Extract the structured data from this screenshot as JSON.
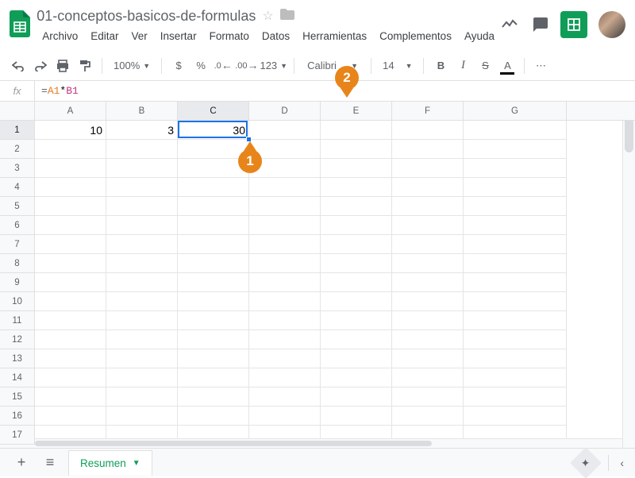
{
  "document": {
    "title": "01-conceptos-basicos-de-formulas"
  },
  "menu": {
    "archivo": "Archivo",
    "editar": "Editar",
    "ver": "Ver",
    "insertar": "Insertar",
    "formato": "Formato",
    "datos": "Datos",
    "herramientas": "Herramientas",
    "complementos": "Complementos",
    "ayuda": "Ayuda"
  },
  "toolbar": {
    "zoom": "100%",
    "currency": "$",
    "percent": "%",
    "dec_less": ".0",
    "dec_more": ".00",
    "num_format": "123",
    "font": "Calibri",
    "size": "14",
    "bold": "B",
    "italic": "I",
    "strike": "S",
    "textcolor": "A",
    "more": "⋯"
  },
  "formula": {
    "fx": "fx",
    "eq": "=",
    "ref1": "A1",
    "op": "*",
    "ref2": "B1"
  },
  "columns": [
    "A",
    "B",
    "C",
    "D",
    "E",
    "F",
    "G"
  ],
  "rows": [
    "1",
    "2",
    "3",
    "4",
    "5",
    "6",
    "7",
    "8",
    "9",
    "10",
    "11",
    "12",
    "13",
    "14",
    "15",
    "16",
    "17"
  ],
  "cells": {
    "A1": "10",
    "B1": "3",
    "C1": "30"
  },
  "active": {
    "col": "C",
    "row": "1"
  },
  "callouts": {
    "c1": "1",
    "c2": "2"
  },
  "sheets": {
    "add": "+",
    "all": "≡",
    "active": "Resumen"
  }
}
